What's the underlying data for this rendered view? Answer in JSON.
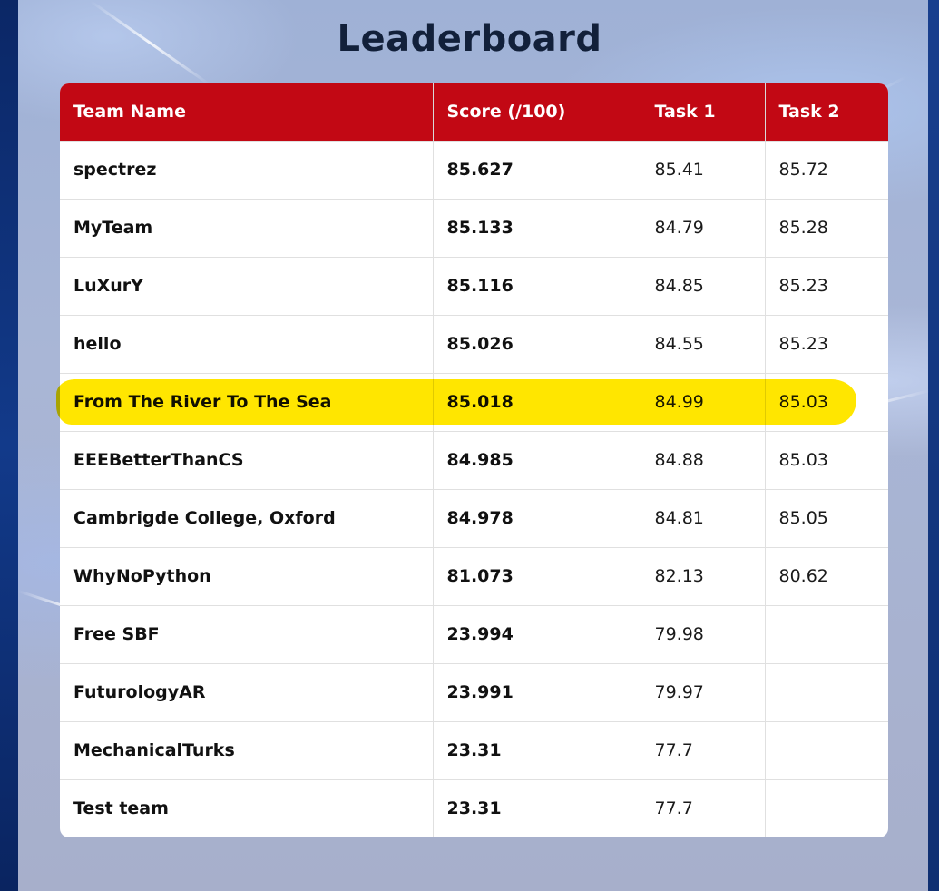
{
  "page": {
    "title": "Leaderboard"
  },
  "table": {
    "headers": [
      "Team Name",
      "Score (/100)",
      "Task 1",
      "Task 2"
    ],
    "rows": [
      {
        "team": "spectrez",
        "score": "85.627",
        "task1": "85.41",
        "task2": "85.72"
      },
      {
        "team": "MyTeam",
        "score": "85.133",
        "task1": "84.79",
        "task2": "85.28"
      },
      {
        "team": "LuXurY",
        "score": "85.116",
        "task1": "84.85",
        "task2": "85.23"
      },
      {
        "team": "hello",
        "score": "85.026",
        "task1": "84.55",
        "task2": "85.23"
      },
      {
        "team": "From The River To The Sea",
        "score": "85.018",
        "task1": "84.99",
        "task2": "85.03",
        "highlighted": true
      },
      {
        "team": "EEEBetterThanCS",
        "score": "84.985",
        "task1": "84.88",
        "task2": "85.03"
      },
      {
        "team": "Cambrigde College, Oxford",
        "score": "84.978",
        "task1": "84.81",
        "task2": "85.05"
      },
      {
        "team": "WhyNoPython",
        "score": "81.073",
        "task1": "82.13",
        "task2": "80.62"
      },
      {
        "team": "Free SBF",
        "score": "23.994",
        "task1": "79.98",
        "task2": ""
      },
      {
        "team": "FuturologyAR",
        "score": "23.991",
        "task1": "79.97",
        "task2": ""
      },
      {
        "team": "MechanicalTurks",
        "score": "23.31",
        "task1": "77.7",
        "task2": ""
      },
      {
        "team": "Test team",
        "score": "23.31",
        "task1": "77.7",
        "task2": ""
      }
    ]
  },
  "colors": {
    "header_bg": "#c20814",
    "header_text": "#ffffff",
    "highlight": "#ffe600",
    "title_text": "#12203a"
  }
}
